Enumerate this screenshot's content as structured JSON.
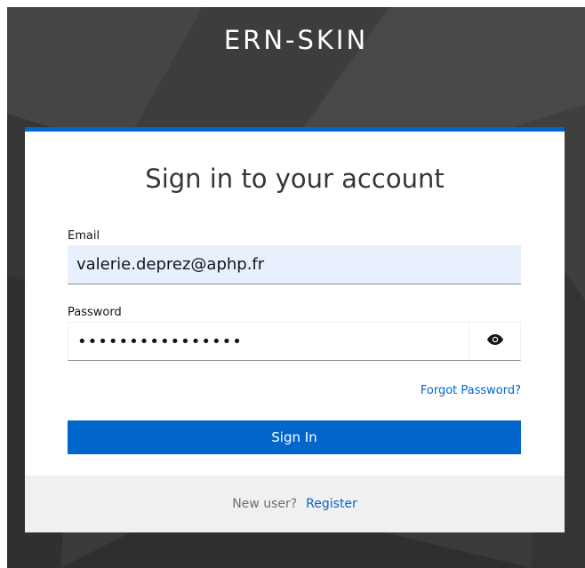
{
  "app": {
    "title": "ERN-SKIN"
  },
  "login": {
    "heading": "Sign in to your account",
    "email_label": "Email",
    "email_value": "valerie.deprez@aphp.fr",
    "password_label": "Password",
    "password_masked": "••••••••••••••••",
    "show_password_icon": "eye-icon",
    "forgot_password": "Forgot Password?",
    "sign_in": "Sign In"
  },
  "footer": {
    "new_user": "New user?",
    "register": "Register"
  },
  "colors": {
    "accent": "#0066cc",
    "background": "#3a3a3a",
    "input_autofill": "#e8f0fe",
    "footer_bg": "#f0f0f0"
  }
}
